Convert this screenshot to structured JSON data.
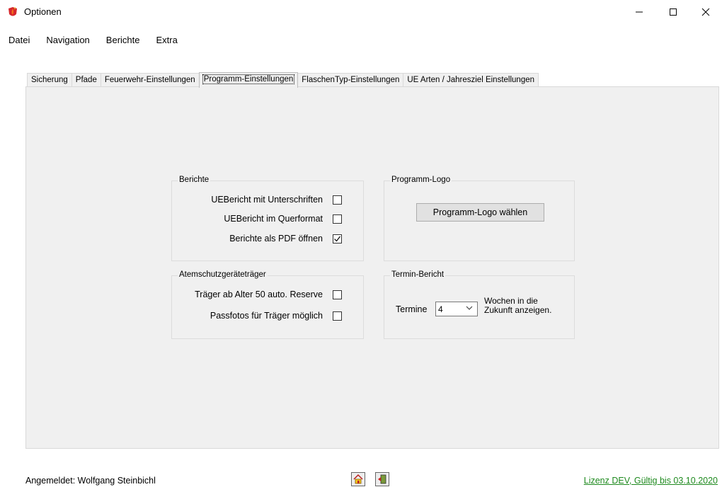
{
  "window": {
    "title": "Optionen",
    "minimize_glyph": "—",
    "maximize_glyph": "☐",
    "close_glyph": "✕"
  },
  "menu": [
    "Datei",
    "Navigation",
    "Berichte",
    "Extra"
  ],
  "tabs": [
    {
      "label": "Sicherung",
      "active": false
    },
    {
      "label": "Pfade",
      "active": false
    },
    {
      "label": "Feuerwehr-Einstellungen",
      "active": false
    },
    {
      "label": "Programm-Einstellungen",
      "active": true
    },
    {
      "label": "FlaschenTyp-Einstellungen",
      "active": false
    },
    {
      "label": "UE Arten / Jahresziel Einstellungen",
      "active": false
    }
  ],
  "berichte": {
    "title": "Berichte",
    "items": [
      {
        "label": "UEBericht mit Unterschriften",
        "checked": false
      },
      {
        "label": "UEBericht im Querformat",
        "checked": false
      },
      {
        "label": "Berichte als PDF öffnen",
        "checked": true
      }
    ]
  },
  "programm_logo": {
    "title": "Programm-Logo",
    "button_label": "Programm-Logo wählen"
  },
  "atemschutz": {
    "title": "Atemschutzgeräteträger",
    "items": [
      {
        "label": "Träger ab Alter 50 auto. Reserve",
        "checked": false
      },
      {
        "label": "Passfotos für Träger möglich",
        "checked": false
      }
    ]
  },
  "termin_bericht": {
    "title": "Termin-Bericht",
    "label": "Termine",
    "value": "4",
    "suffix_line1": "Wochen in die",
    "suffix_line2": "Zukunft anzeigen."
  },
  "status": {
    "user": "Angemeldet: Wolfgang Steinbichl",
    "license": "Lizenz DEV, Gültig bis 03.10.2020",
    "icons": [
      "home-icon",
      "exit-door-icon"
    ]
  },
  "colors": {
    "license_green": "#1f8a1f",
    "app_icon_orange": "#f2711c",
    "app_icon_red": "#d6262c"
  }
}
